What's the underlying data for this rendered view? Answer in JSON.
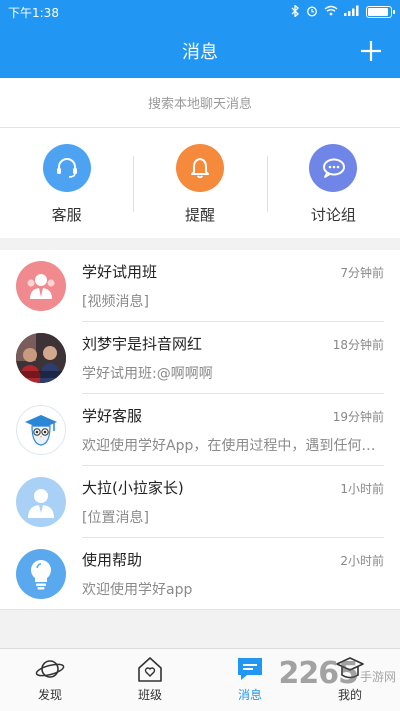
{
  "status_bar": {
    "time": "下午1:38"
  },
  "header": {
    "title": "消息"
  },
  "search": {
    "placeholder": "搜索本地聊天消息"
  },
  "quick_actions": [
    {
      "label": "客服",
      "icon": "headset-icon",
      "color": "#4da3f2"
    },
    {
      "label": "提醒",
      "icon": "bell-icon",
      "color": "#f5893c"
    },
    {
      "label": "讨论组",
      "icon": "chat-bubbles-icon",
      "color": "#6f86e8"
    }
  ],
  "conversations": [
    {
      "name": "学好试用班",
      "time": "7分钟前",
      "message": "[视频消息]",
      "avatar": "group-avatar-icon"
    },
    {
      "name": "刘梦宇是抖音网红",
      "time": "18分钟前",
      "message": "学好试用班:@啊啊啊",
      "avatar": "photo-avatar",
      "avatar_caption": "梦宇就是"
    },
    {
      "name": "学好客服",
      "time": "19分钟前",
      "message": "欢迎使用学好App，在使用过程中，遇到任何问题",
      "avatar": "owl-graduate-icon"
    },
    {
      "name": "大拉(小拉家长)",
      "time": "1小时前",
      "message": "[位置消息]",
      "avatar": "person-avatar-icon"
    },
    {
      "name": "使用帮助",
      "time": "2小时前",
      "message": "欢迎使用学好app",
      "avatar": "lightbulb-icon"
    }
  ],
  "tabs": [
    {
      "label": "发现",
      "icon": "planet-icon",
      "active": false
    },
    {
      "label": "班级",
      "icon": "house-heart-icon",
      "active": false
    },
    {
      "label": "消息",
      "icon": "message-icon",
      "active": true
    },
    {
      "label": "我的",
      "icon": "graduation-cap-icon",
      "active": false
    }
  ],
  "watermark": {
    "number": "2265",
    "text": "手游网"
  },
  "colors": {
    "primary": "#2196f3",
    "background": "#f2f2f2"
  }
}
